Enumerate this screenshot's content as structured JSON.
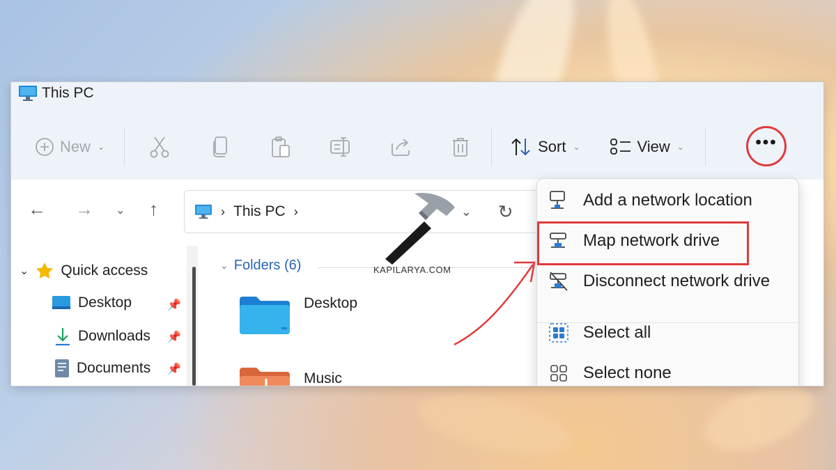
{
  "window": {
    "title": "This PC"
  },
  "toolbar": {
    "new_label": "New",
    "sort_label": "Sort",
    "view_label": "View",
    "more_label": "•••"
  },
  "address": {
    "crumb": "This PC"
  },
  "sidebar": {
    "quick_access": "Quick access",
    "items": [
      {
        "label": "Desktop"
      },
      {
        "label": "Downloads"
      },
      {
        "label": "Documents"
      }
    ]
  },
  "content": {
    "folders_heading": "Folders (6)",
    "folders": [
      {
        "label": "Desktop"
      },
      {
        "label": "Music"
      }
    ]
  },
  "menu": {
    "items": [
      {
        "label": "Add a network location"
      },
      {
        "label": "Map network drive"
      },
      {
        "label": "Disconnect network drive"
      },
      {
        "label": "Select all"
      },
      {
        "label": "Select none"
      }
    ]
  },
  "watermark": "KAPILARYA.COM",
  "colors": {
    "highlight": "#e03a3a",
    "accent": "#2a64b8"
  }
}
